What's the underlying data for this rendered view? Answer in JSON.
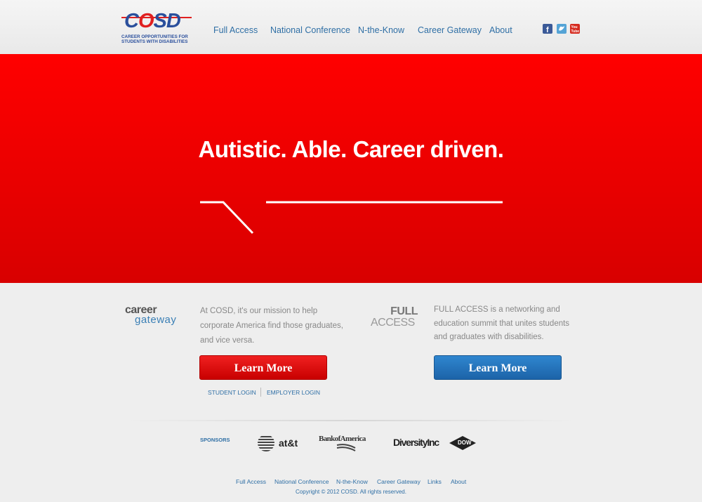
{
  "logo": {
    "wordmark_pre": "C",
    "wordmark_o": "O",
    "wordmark_post": "SD",
    "tagline": "CAREER OPPORTUNITIES FOR STUDENTS WITH DISABILITIES"
  },
  "nav": {
    "items": [
      "Full Access",
      "National Conference",
      "N-the-Know",
      "Career Gateway",
      "About"
    ]
  },
  "social": {
    "icons": [
      "facebook-icon",
      "twitter-icon",
      "youtube-icon"
    ]
  },
  "hero": {
    "headline": "Autistic. Able. Career driven."
  },
  "career_gateway": {
    "logo_top": "career",
    "logo_bottom": "gateway",
    "description": "At COSD, it's our mission to help corporate America find those graduates, and vice versa.",
    "button": "Learn More",
    "student_login": "STUDENT LOGIN",
    "employer_login": "EMPLOYER LOGIN"
  },
  "full_access": {
    "logo_top": "FULL",
    "logo_bottom": "ACCESS",
    "description": "FULL ACCESS is a networking and education summit that unites students and graduates with disabilities.",
    "button": "Learn More"
  },
  "sponsors": {
    "label": "SPONSORS",
    "att": "at&t",
    "boa": "BankofAmerica",
    "diversity": "DiversityInc",
    "dow": "DOW"
  },
  "footer": {
    "links": [
      "Full Access",
      "National Conference",
      "N-the-Know",
      "Career Gateway",
      "Links",
      "About"
    ],
    "copyright": "Copyright © 2012 COSD. All rights reserved."
  },
  "colors": {
    "accent_red": "#ff0000",
    "link_blue": "#2f6fa5",
    "button_blue": "#1c63a8"
  }
}
